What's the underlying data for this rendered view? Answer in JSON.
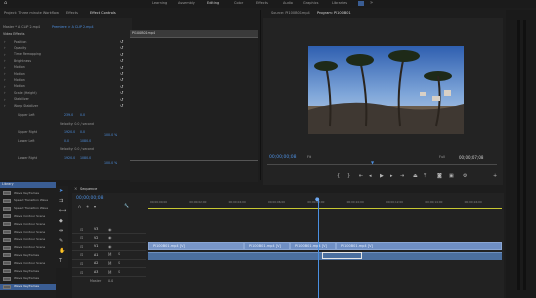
{
  "menu": {
    "items": [
      "Learning",
      "Assembly",
      "Editing",
      "Color",
      "Effects",
      "Audio",
      "Graphics",
      "Libraries"
    ],
    "more": "»",
    "active_index": 2
  },
  "effect_panel": {
    "tabs": [
      "Project: Three minute Workflow",
      "Effects",
      "Effect Controls"
    ],
    "master_line": "Master * A CLIP 2.mp4",
    "sequence_line": "Premiere > A CLIP 2.mp4",
    "clip_label": "Pl100B01mp4",
    "section_video": "Video Effects",
    "rows": [
      "Position",
      "Opacity",
      "Time Remapping",
      "Brightness",
      "Motion",
      "Motion",
      "Motion",
      "Motion",
      "Scale (Height)",
      "Stabilizer",
      "Warp Stabilizer"
    ],
    "sliders": [
      {
        "label": "Upper Left",
        "val1": "239.0",
        "val2": "0.0"
      },
      {
        "label": "Velocity: 0.0 / second",
        "val1": "",
        "val2": ""
      },
      {
        "label": "Upper Right",
        "val1": "1920.0",
        "val2": "0.0"
      },
      {
        "label": "Lower Left",
        "val1": "0.0",
        "val2": "1080.0"
      },
      {
        "label": "Velocity: 0.0 / second",
        "val1": "",
        "val2": ""
      },
      {
        "label": "Lower Right",
        "val1": "1920.0",
        "val2": "1080.0"
      }
    ],
    "pct1": "100.0 %",
    "pct2": "100.0 %",
    "bottom_label": "Audio Effects"
  },
  "program_panel": {
    "tabs": [
      "Source: Pl100B01mp4",
      "Program: Pl100B01"
    ],
    "timecode_left": "00;00;00;08",
    "fit": "Fit",
    "full": "Full",
    "timecode_right": "00;00;07;08"
  },
  "timeline": {
    "tab": "Sequence",
    "timecode": "00;00;00;08",
    "ruler": [
      "00;00;00;00",
      "00;00;02;00",
      "00;00;04;00",
      "00;00;06;00",
      "00;00;08;00",
      "00;00;10;00",
      "00;00;12;00",
      "00;00;14;00",
      "00;00;16;00"
    ],
    "tracks": [
      "V3",
      "V2",
      "V1",
      "A1",
      "A2",
      "A3"
    ],
    "master": "Master",
    "master_val": "0.0",
    "clips": [
      "Pl100B01.mp4 [V]",
      "Pl100B01.mp4 [V]",
      "Pl100B01.mp4 [V]",
      "Pl100B01.mp4 [V]"
    ]
  },
  "media_list": {
    "header": "Library",
    "items": [
      "Wave Keyframes",
      "Speed Transition Wave",
      "Speed Transition Wave",
      "Wave Contour Scene",
      "Wave Contour Scene",
      "Wave Contour Scene",
      "Wave Contour Scene",
      "Wave Contour Scene",
      "Wave Keyframes",
      "Wave Contour Scene",
      "Wave Keyframes",
      "Wave Keyframes",
      "Wave Keyframes"
    ],
    "highlighted_index": 12
  },
  "colors": {
    "accent": "#4d8fe0",
    "clip_fill": "#6f8fc4",
    "selected_clip": "#c5d5f0",
    "playhead": "#4a90e2",
    "timeline_ruler_line": "#c8c832"
  }
}
